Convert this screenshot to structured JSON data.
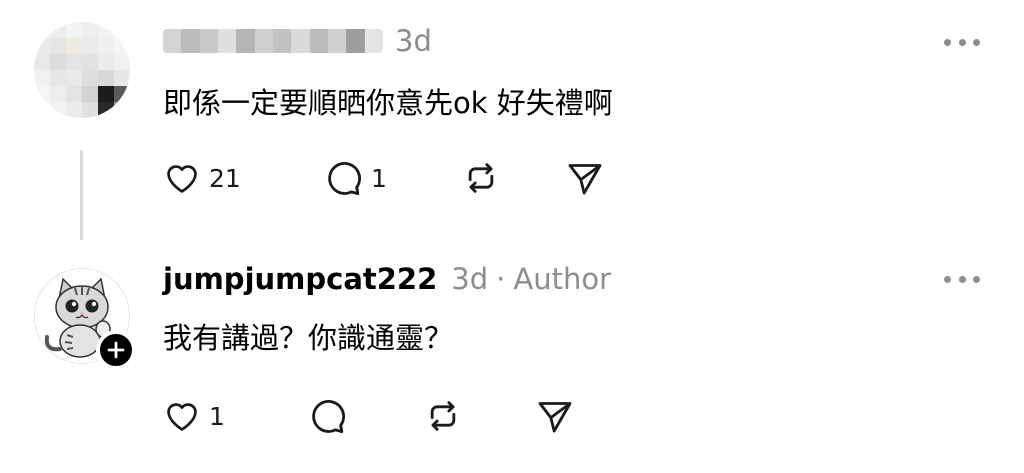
{
  "posts": [
    {
      "timestamp": "3d",
      "author_tag": "",
      "text": "即係一定要順晒你意先ok 好失禮啊",
      "like_count": "21",
      "reply_count": "1",
      "avatar_icon": "pixelated-avatar-icon",
      "username_redacted": true
    },
    {
      "username": "jumpjumpcat222",
      "timestamp": "3d",
      "separator": "·",
      "author_tag": "Author",
      "text": "我有講過？你識通靈？",
      "like_count": "1",
      "reply_count": "",
      "avatar_icon": "cartoon-cat-avatar-icon",
      "follow_icon": "plus-icon"
    }
  ],
  "icons": [
    "heart-icon",
    "comment-icon",
    "repost-icon",
    "share-icon",
    "more-icon"
  ],
  "colors": {
    "text": "#000000",
    "secondary": "#8d8d8d",
    "thread_line": "#d9d9d9",
    "badge": "#000000"
  }
}
